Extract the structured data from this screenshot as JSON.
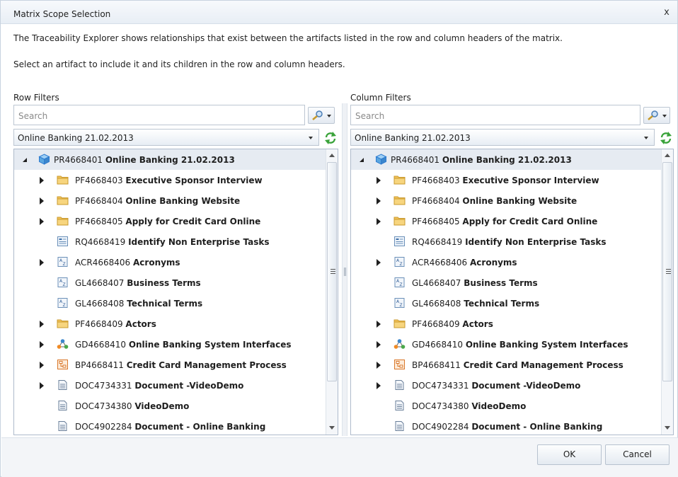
{
  "dialog": {
    "title": "Matrix Scope Selection",
    "close_label": "x",
    "description": "The Traceability Explorer shows relationships that exist between the artifacts listed in the row and column headers of the matrix.",
    "instruction": "Select an artifact to include it and its children in the row and column headers."
  },
  "row_filters": {
    "label": "Row Filters",
    "search_placeholder": "Search",
    "selected_project": "Online Banking 21.02.2013"
  },
  "column_filters": {
    "label": "Column Filters",
    "search_placeholder": "Search",
    "selected_project": "Online Banking 21.02.2013"
  },
  "tree": [
    {
      "id": "PR4668401",
      "name": "Online Banking 21.02.2013",
      "icon": "project-cube-icon",
      "expanded": true,
      "level": 0
    },
    {
      "id": "PF4668403",
      "name": "Executive Sponsor Interview",
      "icon": "folder-icon",
      "expandable": true,
      "level": 1
    },
    {
      "id": "PF4668404",
      "name": "Online Banking Website",
      "icon": "folder-icon",
      "expandable": true,
      "level": 1
    },
    {
      "id": "PF4668405",
      "name": "Apply for Credit Card Online",
      "icon": "folder-icon",
      "expandable": true,
      "level": 1
    },
    {
      "id": "RQ4668419",
      "name": "Identify Non Enterprise Tasks",
      "icon": "requirement-icon",
      "expandable": false,
      "level": 1
    },
    {
      "id": "ACR4668406",
      "name": "Acronyms",
      "icon": "glossary-icon",
      "expandable": true,
      "level": 1
    },
    {
      "id": "GL4668407",
      "name": "Business Terms",
      "icon": "glossary-icon",
      "expandable": false,
      "level": 1
    },
    {
      "id": "GL4668408",
      "name": "Technical Terms",
      "icon": "glossary-icon",
      "expandable": false,
      "level": 1
    },
    {
      "id": "PF4668409",
      "name": "Actors",
      "icon": "folder-icon",
      "expandable": true,
      "level": 1
    },
    {
      "id": "GD4668410",
      "name": "Online Banking System Interfaces",
      "icon": "diagram-icon",
      "expandable": true,
      "level": 1
    },
    {
      "id": "BP4668411",
      "name": "Credit Card Management Process",
      "icon": "process-icon",
      "expandable": true,
      "level": 1
    },
    {
      "id": "DOC4734331",
      "name": "Document -VideoDemo",
      "icon": "document-icon",
      "expandable": true,
      "level": 1
    },
    {
      "id": "DOC4734380",
      "name": "VideoDemo",
      "icon": "document-icon",
      "expandable": false,
      "level": 1
    },
    {
      "id": "DOC4902284",
      "name": "Document - Online Banking",
      "icon": "document-icon",
      "expandable": false,
      "level": 1
    }
  ],
  "buttons": {
    "ok": "OK",
    "cancel": "Cancel"
  },
  "colors": {
    "folder": "#f3c35a",
    "accent": "#2e7bcf",
    "refresh": "#3aa33a"
  }
}
